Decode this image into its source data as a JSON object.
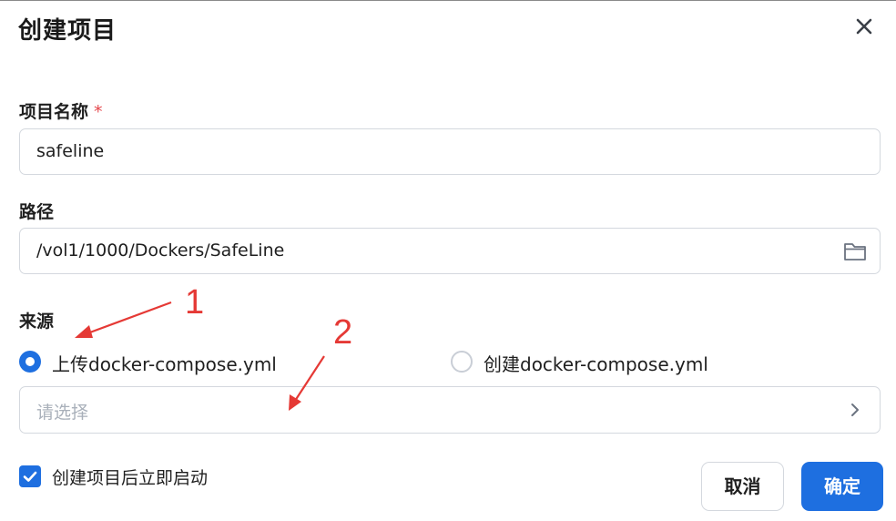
{
  "dialog": {
    "title": "创建项目",
    "close_icon": "close-icon"
  },
  "form": {
    "name": {
      "label": "项目名称",
      "required_mark": "*",
      "value": "safeline"
    },
    "path": {
      "label": "路径",
      "value": "/vol1/1000/Dockers/SafeLine",
      "icon": "folder-icon"
    },
    "source": {
      "label": "来源",
      "options": [
        {
          "label": "上传docker-compose.yml",
          "selected": true
        },
        {
          "label": "创建docker-compose.yml",
          "selected": false
        }
      ],
      "select_placeholder": "请选择",
      "select_icon": "chevron-right-icon"
    },
    "autostart": {
      "label": "创建项目后立即启动",
      "checked": true
    }
  },
  "footer": {
    "cancel_label": "取消",
    "ok_label": "确定"
  },
  "annotations": {
    "label_1": "1",
    "label_2": "2",
    "color": "#e53935"
  },
  "colors": {
    "accent": "#1e6fe0",
    "required": "#e5484d",
    "placeholder": "#a9b0ba"
  }
}
